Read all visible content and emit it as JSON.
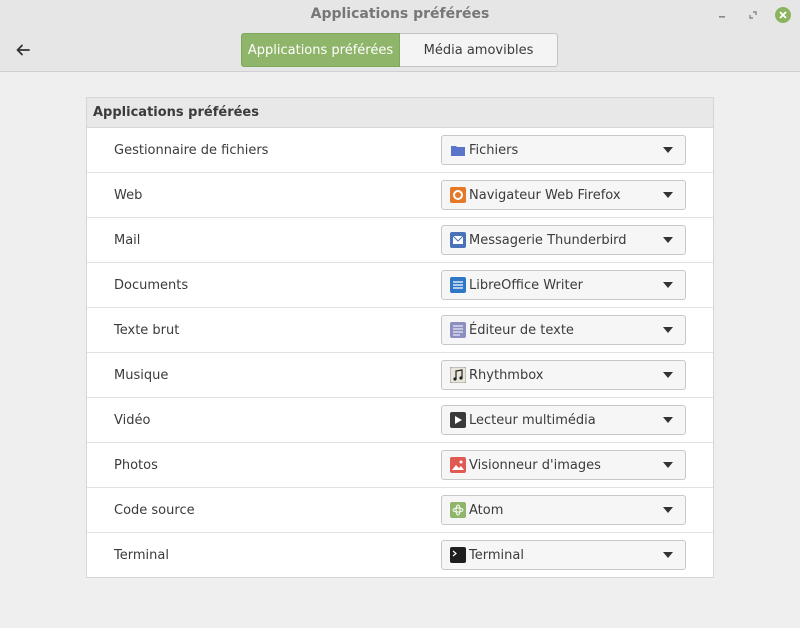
{
  "window": {
    "title": "Applications préférées"
  },
  "tabs": [
    {
      "label": "Applications préférées",
      "active": true
    },
    {
      "label": "Média amovibles",
      "active": false
    }
  ],
  "section": {
    "title": "Applications préférées"
  },
  "rows": [
    {
      "label": "Gestionnaire de fichiers",
      "value": "Fichiers",
      "icon": "folder-icon",
      "icon_color": "#5a75c8"
    },
    {
      "label": "Web",
      "value": "Navigateur Web Firefox",
      "icon": "firefox-icon",
      "icon_color": "#e6782a"
    },
    {
      "label": "Mail",
      "value": "Messagerie Thunderbird",
      "icon": "thunderbird-icon",
      "icon_color": "#4a72b8"
    },
    {
      "label": "Documents",
      "value": "LibreOffice Writer",
      "icon": "writer-icon",
      "icon_color": "#2e77c6"
    },
    {
      "label": "Texte brut",
      "value": "Éditeur de texte",
      "icon": "text-editor-icon",
      "icon_color": "#8d8fc2"
    },
    {
      "label": "Musique",
      "value": "Rhythmbox",
      "icon": "rhythmbox-icon",
      "icon_color": "#e9e5d8"
    },
    {
      "label": "Vidéo",
      "value": "Lecteur multimédia",
      "icon": "media-player-icon",
      "icon_color": "#3a3a3a"
    },
    {
      "label": "Photos",
      "value": "Visionneur d'images",
      "icon": "image-viewer-icon",
      "icon_color": "#e05a52"
    },
    {
      "label": "Code source",
      "value": "Atom",
      "icon": "atom-icon",
      "icon_color": "#8fb56a"
    },
    {
      "label": "Terminal",
      "value": "Terminal",
      "icon": "terminal-icon",
      "icon_color": "#1e1e1e"
    }
  ],
  "colors": {
    "accent": "#8fb56a",
    "close_button": "#8ab560"
  }
}
